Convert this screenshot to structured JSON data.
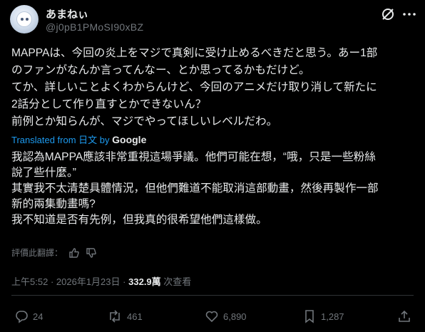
{
  "author": {
    "display_name": "あまねぃ",
    "handle": "@j0pB1PMoSI90xBZ"
  },
  "post": {
    "lines": [
      "MAPPAは、今回の炎上をマジで真剣に受け止めるべきだと思う。あー1部",
      "のファンがなんか言ってんなー、とか思ってるかもだけど。",
      "てか、詳しいことよくわからんけど、今回のアニメだけ取り消して新たに",
      "2話分として作り直すとかできないん？",
      "前例とか知らんが、マジでやってほしいレベルだわ。"
    ]
  },
  "translation": {
    "label": "Translated from 日文 by",
    "provider": "Google",
    "lines": [
      "我認為MAPPA應該非常重視這場爭議。他們可能在想，“哦，只是一些粉絲",
      "說了些什麼。”",
      "其實我不太清楚具體情況，但他們難道不能取消這部動畫，然後再製作一部",
      "新的兩集動畫嗎?",
      "我不知道是否有先例，但我真的很希望他們這樣做。"
    ],
    "rate_label": "評價此翻譯："
  },
  "meta": {
    "time": "上午5:52",
    "date": "2026年1月23日",
    "views": "332.9萬",
    "views_label": "次查看"
  },
  "actions": {
    "replies": "24",
    "reposts": "461",
    "likes": "6,890",
    "bookmarks": "1,287"
  },
  "icons": [
    "grok-icon",
    "more-icon",
    "thumbs-up-icon",
    "thumbs-down-icon",
    "reply-icon",
    "repost-icon",
    "like-icon",
    "bookmark-icon",
    "share-icon"
  ],
  "colors": {
    "background": "#000000",
    "text": "#e7e9ea",
    "muted": "#71767b",
    "link": "#1d9bf0"
  }
}
